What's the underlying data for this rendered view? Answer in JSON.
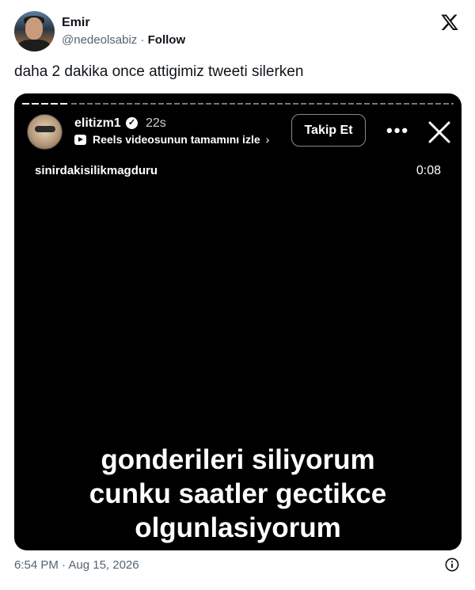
{
  "author": {
    "name": "Emir",
    "handle": "@nedeolsabiz",
    "separator": " · ",
    "follow_label": "Follow"
  },
  "tweet": {
    "text": "daha 2 dakika once attigimiz tweeti silerken",
    "timestamp": "6:54 PM · Aug 15, 2026"
  },
  "media": {
    "username": "elitizm1",
    "time_ago": "22s",
    "reels_text": "Reels videosunun tamamını izle",
    "follow_button": "Takip Et",
    "more_label": "•••",
    "audio_user": "sinirdakisilikmagduru",
    "duration": "0:08",
    "caption_lines": [
      "gonderileri siliyorum",
      "cunku saatler gectikce",
      "olgunlasiyorum"
    ]
  },
  "icons": {
    "brand": "x-logo-icon",
    "verified": "verified-check-icon",
    "play": "play-icon",
    "chevron": "chevron-right-icon",
    "close": "close-icon",
    "info": "info-icon"
  }
}
